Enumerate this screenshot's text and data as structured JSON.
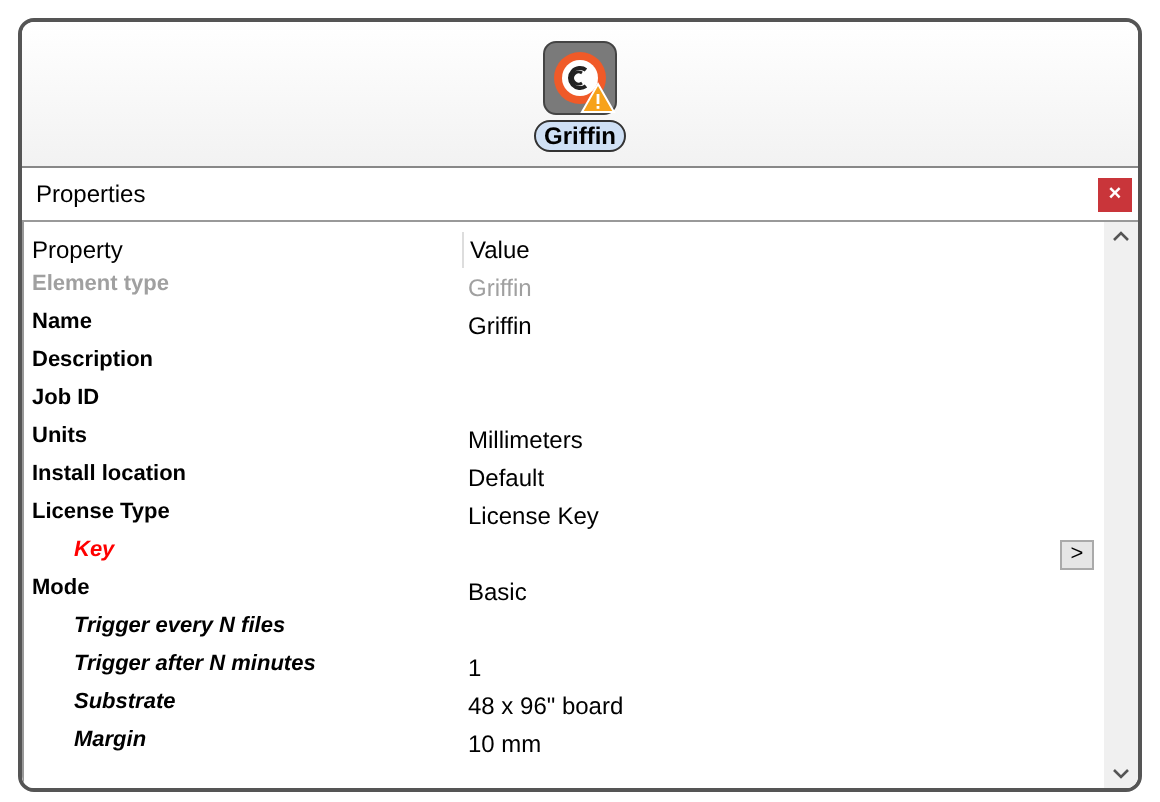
{
  "element": {
    "label": "Griffin",
    "warning": true
  },
  "panel": {
    "title": "Properties",
    "close": "×"
  },
  "grid": {
    "columns": [
      "Property",
      "Value"
    ],
    "rows": [
      {
        "kind": "disabled",
        "property": "Element type",
        "value": "Griffin"
      },
      {
        "kind": "normal",
        "property": "Name",
        "value": "Griffin"
      },
      {
        "kind": "normal",
        "property": "Description"
      },
      {
        "kind": "normal",
        "property": "Job ID"
      },
      {
        "kind": "normal",
        "property": "Units",
        "value": "Millimeters"
      },
      {
        "kind": "normal",
        "property": "Install location",
        "value": "Default"
      },
      {
        "kind": "normal",
        "property": "License Type",
        "value": "License Key"
      },
      {
        "kind": "required",
        "property": "Key",
        "button": ">"
      },
      {
        "kind": "normal",
        "property": "Mode",
        "value": "Basic"
      },
      {
        "kind": "child",
        "property": "Trigger every N files"
      },
      {
        "kind": "child",
        "property": "Trigger after N minutes",
        "value": "1"
      },
      {
        "kind": "child",
        "property": "Substrate",
        "value": "48 x 96\" board"
      },
      {
        "kind": "child",
        "property": "Margin",
        "value": "10 mm"
      }
    ]
  }
}
